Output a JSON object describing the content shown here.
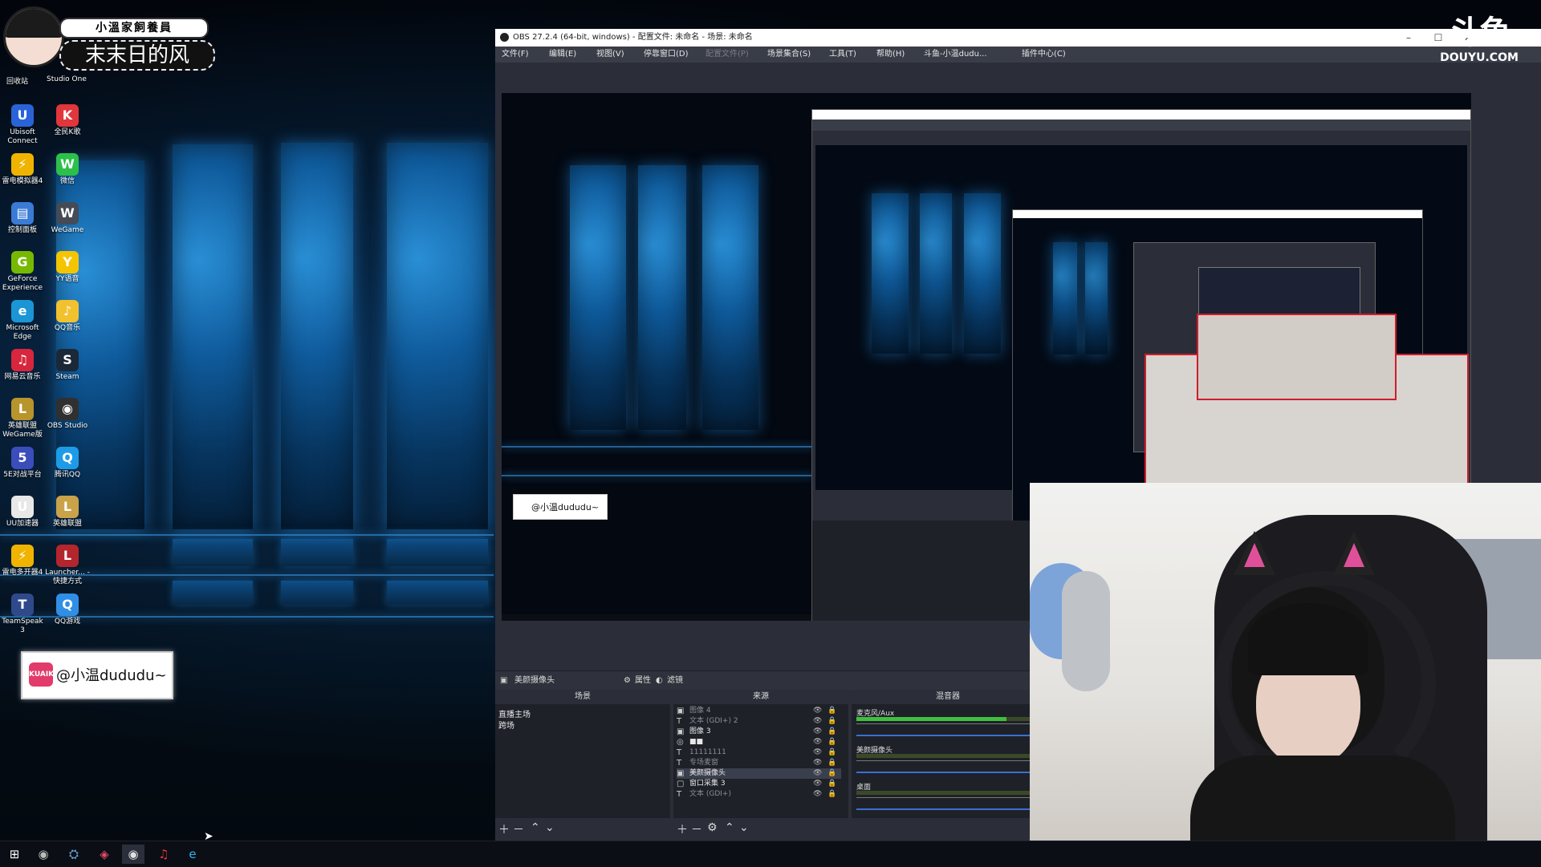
{
  "logo": {
    "title": "小溫家飼養員",
    "subtitle": "末末日的风"
  },
  "desktop_icons": [
    {
      "label": "回收站",
      "color": "#6a8fb8",
      "glyph": "♻"
    },
    {
      "label": "Studio One",
      "color": "#2a63b8",
      "glyph": "S"
    },
    {
      "label": "Ubisoft Connect",
      "color": "#2a63d8",
      "glyph": "U"
    },
    {
      "label": "全民K歌",
      "color": "#e0363c",
      "glyph": "K"
    },
    {
      "label": "雷电模拟器4",
      "color": "#f0b400",
      "glyph": "⚡"
    },
    {
      "label": "微信",
      "color": "#2cc04a",
      "glyph": "W"
    },
    {
      "label": "控制面板",
      "color": "#3a7bd5",
      "glyph": "▤"
    },
    {
      "label": "WeGame",
      "color": "#444b56",
      "glyph": "W"
    },
    {
      "label": "GeForce Experience",
      "color": "#76b900",
      "glyph": "G"
    },
    {
      "label": "YY语音",
      "color": "#f5c400",
      "glyph": "Y"
    },
    {
      "label": "Microsoft Edge",
      "color": "#1b95d6",
      "glyph": "e"
    },
    {
      "label": "QQ音乐",
      "color": "#f2c12e",
      "glyph": "♪"
    },
    {
      "label": "网易云音乐",
      "color": "#d7263d",
      "glyph": "♫"
    },
    {
      "label": "Steam",
      "color": "#1b2838",
      "glyph": "S"
    },
    {
      "label": "英雄联盟 WeGame版",
      "color": "#b8942c",
      "glyph": "L"
    },
    {
      "label": "OBS Studio",
      "color": "#303030",
      "glyph": "◉"
    },
    {
      "label": "5E对战平台",
      "color": "#3b4dbb",
      "glyph": "5"
    },
    {
      "label": "腾讯QQ",
      "color": "#1e9be8",
      "glyph": "Q"
    },
    {
      "label": "UU加速器",
      "color": "#e8e8e8",
      "glyph": "U"
    },
    {
      "label": "英雄联盟",
      "color": "#c9a24a",
      "glyph": "L"
    },
    {
      "label": "雷电多开器4",
      "color": "#f0b400",
      "glyph": "⚡"
    },
    {
      "label": "Launcher... - 快捷方式",
      "color": "#b3262d",
      "glyph": "L"
    },
    {
      "label": "TeamSpeak 3",
      "color": "#2f4a8a",
      "glyph": "T"
    },
    {
      "label": "QQ游戏",
      "color": "#2f8fe6",
      "glyph": "Q"
    }
  ],
  "badge": {
    "platform": "KUAIKAN",
    "handle": "@小温dududu~"
  },
  "obs": {
    "title": "OBS 27.2.4 (64-bit, windows) - 配置文件: 未命名 - 场景: 未命名",
    "menu": [
      {
        "label": "文件(F)",
        "enabled": true
      },
      {
        "label": "编辑(E)",
        "enabled": true
      },
      {
        "label": "视图(V)",
        "enabled": true
      },
      {
        "label": "停靠窗口(D)",
        "enabled": true
      },
      {
        "label": "配置文件(P)",
        "enabled": false
      },
      {
        "label": "场景集合(S)",
        "enabled": true
      },
      {
        "label": "工具(T)",
        "enabled": true
      },
      {
        "label": "帮助(H)",
        "enabled": true
      },
      {
        "label": "斗鱼-小温dudu...",
        "enabled": true
      },
      {
        "label": "插件中心(C)",
        "enabled": true
      }
    ],
    "source_bar": {
      "selected": "美颜摄像头",
      "properties": "属性",
      "filters": "滤镜"
    },
    "docks": {
      "scenes": "场景",
      "sources": "来源",
      "mixer": "混音器"
    },
    "scenes": [
      "直播主场",
      "跨场"
    ],
    "sources": [
      {
        "icon": "▣",
        "name": "图像 4",
        "dim": true
      },
      {
        "icon": "T",
        "name": "文本 (GDI+) 2",
        "dim": true
      },
      {
        "icon": "▣",
        "name": "图像 3",
        "dim": false
      },
      {
        "icon": "◎",
        "name": "■■",
        "dim": false
      },
      {
        "icon": "T",
        "name": "11111111",
        "dim": true
      },
      {
        "icon": "T",
        "name": "专场麦窗",
        "dim": true
      },
      {
        "icon": "▣",
        "name": "美颜摄像头",
        "dim": false
      },
      {
        "icon": "▢",
        "name": "窗口采集 3",
        "dim": false
      },
      {
        "icon": "T",
        "name": "文本 (GDI+)",
        "dim": true
      }
    ],
    "mixer": [
      {
        "name": "麦克风/Aux",
        "level": 0.85
      },
      {
        "name": "美颜摄像头",
        "level": 0.0
      },
      {
        "name": "桌面",
        "level": 0.0
      }
    ]
  },
  "watermark": {
    "logo": "斗鱼",
    "domain": "DOUYU.COM"
  }
}
